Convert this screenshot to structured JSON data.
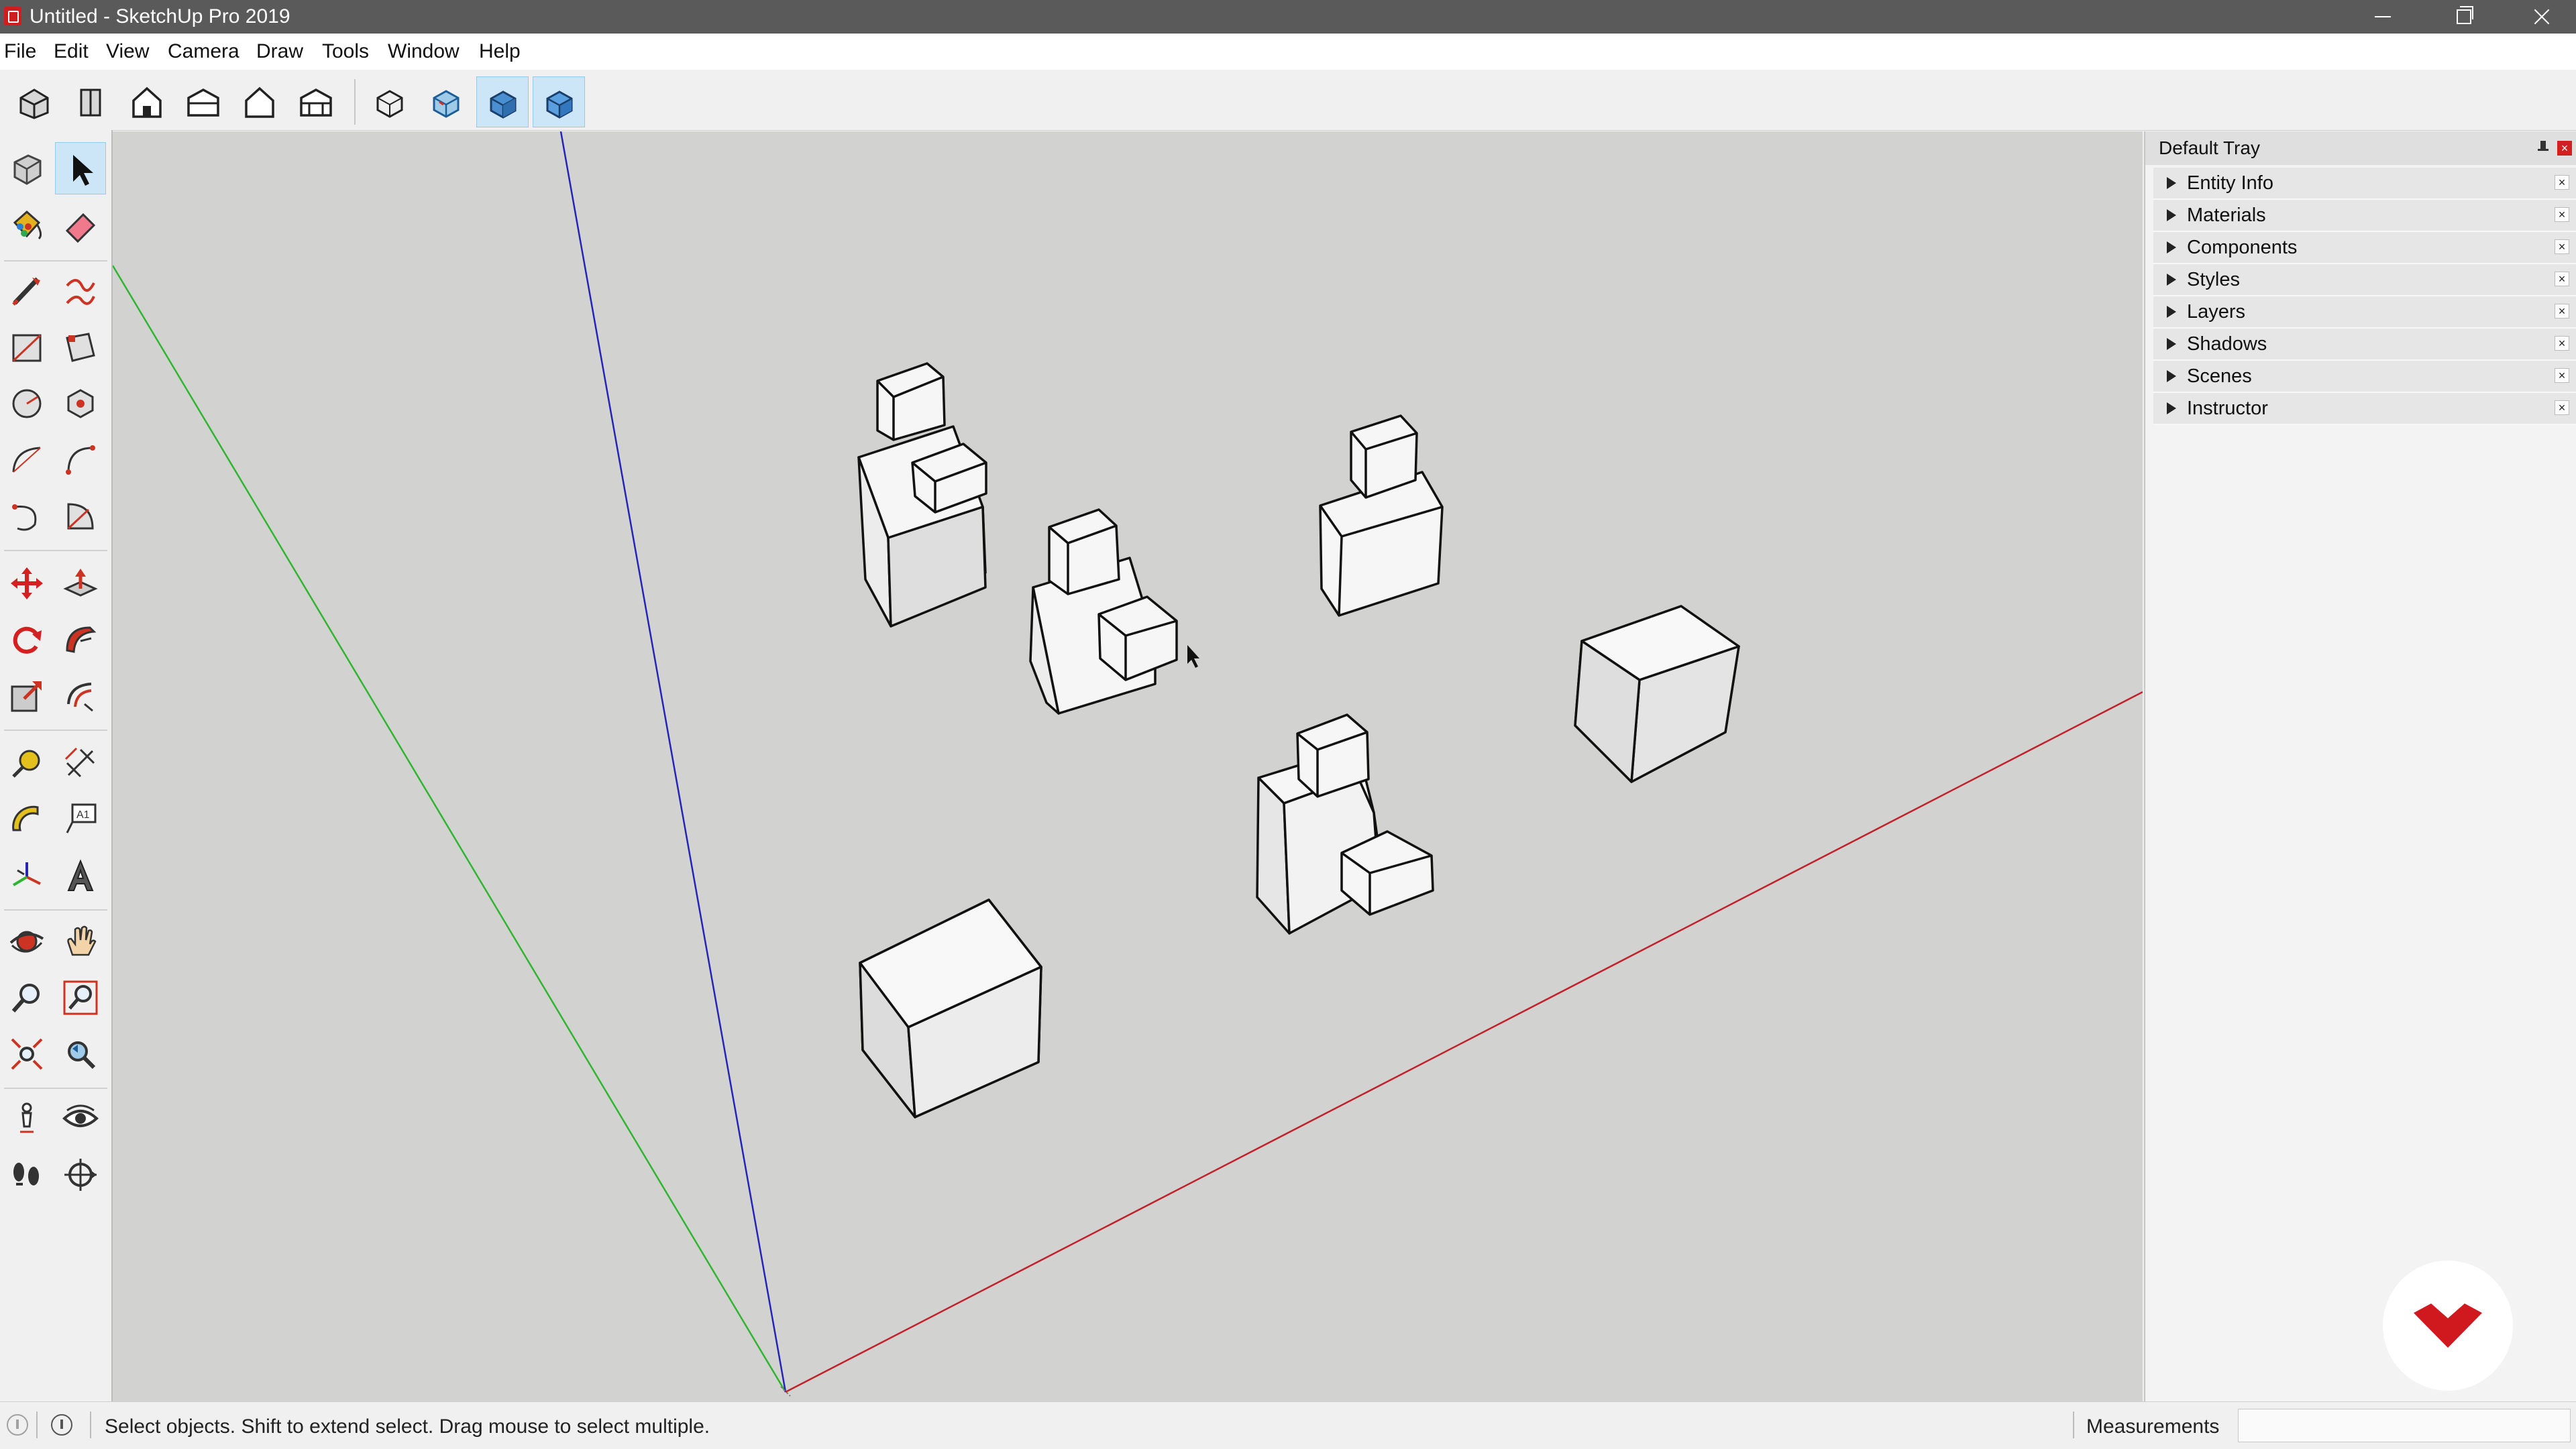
{
  "window": {
    "title": "Untitled - SketchUp Pro 2019"
  },
  "menu": [
    {
      "label": "File"
    },
    {
      "label": "Edit"
    },
    {
      "label": "View"
    },
    {
      "label": "Camera"
    },
    {
      "label": "Draw"
    },
    {
      "label": "Tools"
    },
    {
      "label": "Window"
    },
    {
      "label": "Help"
    }
  ],
  "top_toolbar": {
    "buttons": [
      {
        "icon": "iso-view-icon"
      },
      {
        "icon": "top-view-icon"
      },
      {
        "icon": "front-view-icon"
      },
      {
        "icon": "right-view-icon"
      },
      {
        "icon": "back-view-icon"
      },
      {
        "icon": "left-view-icon"
      },
      {
        "icon": "xray-icon"
      },
      {
        "icon": "wireframe-icon"
      },
      {
        "icon": "shaded-icon",
        "active": true
      },
      {
        "icon": "shaded-textures-icon",
        "active": true
      }
    ]
  },
  "left_toolbar": {
    "tools": [
      "make-component-icon",
      "select-icon",
      "paint-bucket-icon",
      "eraser-icon",
      "line-icon",
      "freehand-icon",
      "rectangle-icon",
      "rotated-rectangle-icon",
      "circle-icon",
      "polygon-icon",
      "arc-icon",
      "two-point-arc-icon",
      "three-point-arc-icon",
      "pie-icon",
      "move-icon",
      "push-pull-icon",
      "rotate-icon",
      "follow-me-icon",
      "scale-icon",
      "offset-icon",
      "tape-measure-icon",
      "dimension-icon",
      "protractor-icon",
      "text-icon",
      "axes-icon",
      "3d-text-icon",
      "orbit-icon",
      "pan-icon",
      "zoom-icon",
      "zoom-window-icon",
      "zoom-extents-icon",
      "previous-view-icon",
      "position-camera-icon",
      "look-around-icon",
      "walk-icon",
      "section-plane-icon"
    ],
    "active_tool": "select-icon"
  },
  "tray": {
    "title": "Default Tray",
    "close_label": "×",
    "panels": [
      {
        "label": "Entity Info"
      },
      {
        "label": "Materials"
      },
      {
        "label": "Components"
      },
      {
        "label": "Styles"
      },
      {
        "label": "Layers"
      },
      {
        "label": "Shadows"
      },
      {
        "label": "Scenes"
      },
      {
        "label": "Instructor"
      }
    ],
    "panel_close_label": "×"
  },
  "status": {
    "message": "Select objects. Shift to extend select. Drag mouse to select multiple.",
    "measurements_label": "Measurements",
    "measurements_value": ""
  },
  "colors": {
    "viewport_bg": "#d2d2d0",
    "axis_red": "#c3202a",
    "axis_green": "#2fb52f",
    "axis_blue": "#2424b8",
    "face": "#f6f6f6",
    "face_shade": "#dedede",
    "logo_red": "#d0181f"
  }
}
